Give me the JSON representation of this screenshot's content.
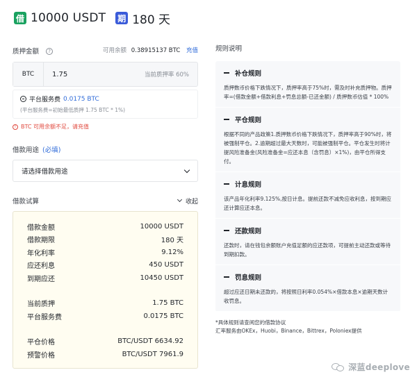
{
  "header": {
    "loan_tag": "借",
    "loan_amount": "10000 USDT",
    "term_tag": "期",
    "term": "180 天"
  },
  "collateral": {
    "label": "质押金额",
    "hint": "?",
    "available_label": "可用余额",
    "available_value": "0.38915137 BTC",
    "recharge_link": "充值",
    "unit": "BTC",
    "amount": "1.75",
    "current_rate": "当前质押率 60%",
    "fee_label": "平台服务费",
    "fee_value": "0.0175 BTC",
    "fee_note": "(平台服务费=初始最低质押 1.75 BTC * 1%)",
    "warning_icon": "!",
    "warning": "BTC 可用余额不足，请充值"
  },
  "purpose": {
    "label": "借款用途",
    "required": "(必填)",
    "placeholder": "请选择借款用途"
  },
  "calc": {
    "title": "借款试算",
    "collapse": "收起",
    "rows_a": [
      {
        "k": "借款金额",
        "v": "10000 USDT"
      },
      {
        "k": "借款期限",
        "v": "180 天"
      },
      {
        "k": "年化利率",
        "v": "9.12%"
      },
      {
        "k": "应还利息",
        "v": "450 USDT"
      },
      {
        "k": "到期应还",
        "v": "10450 USDT"
      }
    ],
    "rows_b": [
      {
        "k": "当前质押",
        "v": "1.75 BTC"
      },
      {
        "k": "平台服务费",
        "v": "0.0175 BTC"
      }
    ],
    "rows_c": [
      {
        "k": "平仓价格",
        "v": "BTC/USDT 6634.92"
      },
      {
        "k": "预警价格",
        "v": "BTC/USDT 7961.9"
      }
    ]
  },
  "rules": {
    "title": "规则说明",
    "items": [
      {
        "title": "补仓规则",
        "body": "质押数币价格下跌情况下，质押率高于75%时，需及时补充质押物。质押率=(借款金额+借款利息+罚息总额-已还金额) / 质押数币估值 * 100%"
      },
      {
        "title": "平仓规则",
        "body": "根据不同的产品政策1.质押数币价格下跌情况下，质押率高于90%时，将被强制平仓。2.逾期超过最大天数时，可能被强制平仓。平仓发生时将计提风险准备金(风险准备金=应还本息（含罚息）×1%)，由平仓所得支付。"
      },
      {
        "title": "计息规则",
        "body": "该产品年化利率9.125%,按日计息。提前还款不减免应收利息，按到期应还计算应还本息。"
      },
      {
        "title": "还款规则",
        "body": "还款时，请在钱包余额账户充值足额的应还款项，可提前主动还款或等待到期扣款。"
      },
      {
        "title": "罚息规则",
        "body": "超过应还日期未还款的，将按照日利率0.054%×借款本息×逾期天数计收罚息。"
      }
    ],
    "footnote_1": "*具体规则请查阅您的借款协议",
    "footnote_2": "汇率服务由OKEx，Huobi，Binance，Bittrex，Poloniex提供"
  },
  "watermark": {
    "text": "深蓝deeplove"
  }
}
